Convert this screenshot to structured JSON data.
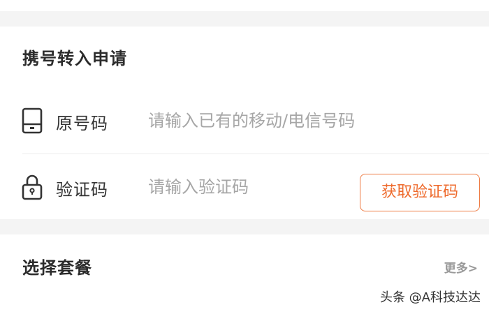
{
  "transfer": {
    "title": "携号转入申请",
    "original_number": {
      "label": "原号码",
      "icon": "phone-icon",
      "placeholder": "请输入已有的移动/电信号码",
      "value": ""
    },
    "verification": {
      "label": "验证码",
      "icon": "lock-icon",
      "placeholder": "请输入验证码",
      "value": "",
      "button_label": "获取验证码"
    }
  },
  "package": {
    "title": "选择套餐",
    "more_label": "更多>"
  },
  "watermark": "头条 @A科技达达",
  "colors": {
    "accent": "#ee6a2c",
    "background": "#f4f4f4",
    "card": "#ffffff",
    "placeholder": "#a6a6a6"
  }
}
